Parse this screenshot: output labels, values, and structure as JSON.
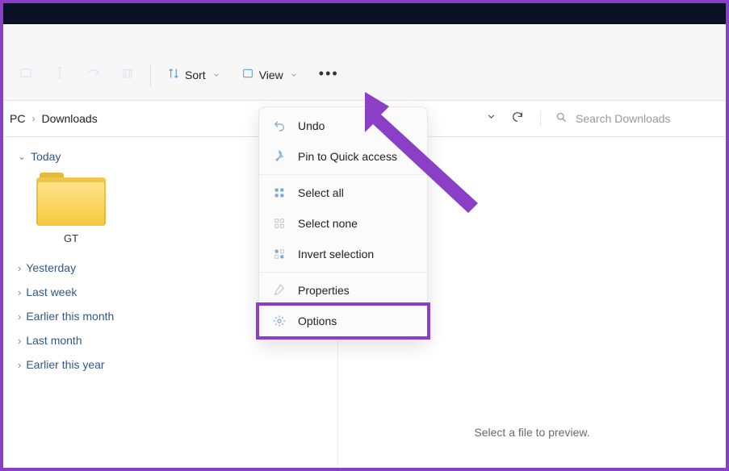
{
  "window": {
    "title": ""
  },
  "toolbar": {
    "sort_label": "Sort",
    "view_label": "View"
  },
  "breadcrumb": {
    "items": [
      "PC",
      "Downloads"
    ]
  },
  "search": {
    "placeholder": "Search Downloads"
  },
  "section": {
    "today": "Today"
  },
  "folder": {
    "name": "GT"
  },
  "groups": {
    "yesterday": "Yesterday",
    "last_week": "Last week",
    "earlier_month": "Earlier this month",
    "last_month": "Last month",
    "earlier_year": "Earlier this year"
  },
  "preview": {
    "empty": "Select a file to preview."
  },
  "menu": {
    "undo": "Undo",
    "pin": "Pin to Quick access",
    "select_all": "Select all",
    "select_none": "Select none",
    "invert": "Invert selection",
    "properties": "Properties",
    "options": "Options"
  }
}
